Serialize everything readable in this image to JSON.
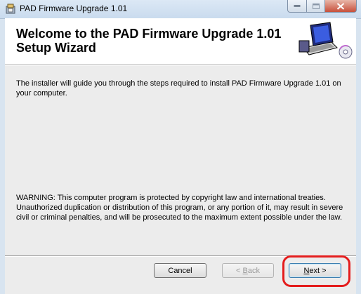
{
  "window": {
    "title": "PAD Firmware Upgrade 1.01"
  },
  "header": {
    "title_line1": "Welcome to the PAD Firmware Upgrade 1.01",
    "title_line2": "Setup Wizard",
    "graphic_icon": "computer-setup-icon"
  },
  "body": {
    "intro": "The installer will guide you through the steps required to install PAD Firmware Upgrade 1.01 on your computer.",
    "warning": "WARNING: This computer program is protected by copyright law and international treaties. Unauthorized duplication or distribution of this program, or any portion of it, may result in severe civil or criminal penalties, and will be prosecuted to the maximum extent possible under the law."
  },
  "buttons": {
    "cancel": "Cancel",
    "back_arrow": "< ",
    "back_key": "B",
    "back_rest": "ack",
    "next_key": "N",
    "next_rest": "ext >"
  },
  "colors": {
    "annotation_highlight": "#e41d1d"
  }
}
